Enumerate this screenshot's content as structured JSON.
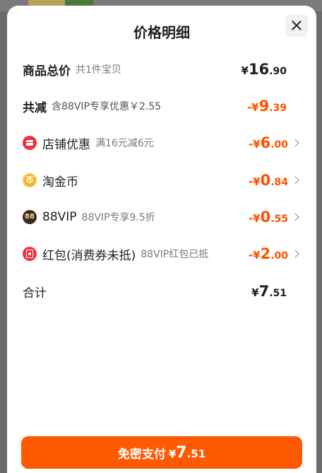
{
  "sheet": {
    "title": "价格明细",
    "close_label": "×"
  },
  "rows": {
    "total_goods": {
      "label": "商品总价",
      "sub": "共1件宝贝",
      "amount": {
        "prefix": "¥",
        "int": "16",
        "dec": ".90"
      }
    },
    "total_reduce": {
      "label": "共减",
      "sub": "含88VIP专享优惠￥2.55",
      "amount": {
        "prefix": "-¥",
        "int": "9",
        "dec": ".39"
      }
    },
    "shop_discount": {
      "icon": "shop-icon",
      "label": "店铺优惠",
      "sub": "满16元减6元",
      "amount": {
        "prefix": "-¥",
        "int": "6",
        "dec": ".00"
      }
    },
    "taojinbi": {
      "icon": "coin-icon",
      "icon_glyph": "币",
      "label": "淘金币",
      "amount": {
        "prefix": "-¥",
        "int": "0",
        "dec": ".84"
      }
    },
    "vip": {
      "icon": "88vip-icon",
      "icon_glyph": "88",
      "label": "88VIP",
      "sub": "88VIP专享9.5折",
      "amount": {
        "prefix": "-¥",
        "int": "0",
        "dec": ".55"
      }
    },
    "redpacket": {
      "icon": "red-packet-icon",
      "label": "红包(消费券未抵)",
      "sub": "88VIP红包已抵",
      "amount": {
        "prefix": "-¥",
        "int": "2",
        "dec": ".00"
      }
    },
    "subtotal": {
      "label": "合计",
      "amount": {
        "prefix": "¥",
        "int": "7",
        "dec": ".51"
      }
    }
  },
  "pay_button": {
    "label": "免密支付",
    "amount": {
      "prefix": "¥",
      "int": "7",
      "dec": ".51"
    }
  },
  "colors": {
    "accent": "#ff5000",
    "button": "#ff5a00",
    "text": "#1f1f1f",
    "muted": "#7a7a7a"
  }
}
